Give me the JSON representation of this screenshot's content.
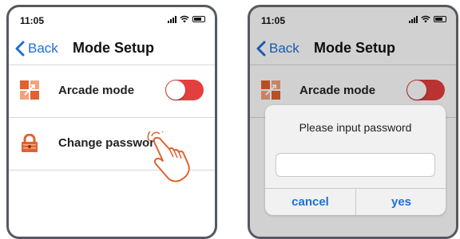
{
  "left_screen": {
    "status_time": "11:05",
    "back_label": "Back",
    "title": "Mode Setup",
    "rows": [
      {
        "label": "Arcade mode"
      },
      {
        "label": "Change password"
      }
    ]
  },
  "right_screen": {
    "status_time": "11:05",
    "back_label": "Back",
    "title": "Mode Setup",
    "rows": [
      {
        "label": "Arcade mode"
      }
    ],
    "dialog": {
      "title": "Please input password",
      "input_value": "",
      "cancel_label": "cancel",
      "yes_label": "yes"
    }
  },
  "colors": {
    "accent": "#1d6fd6",
    "toggle_on": "#e53e3e",
    "icon_orange": "#e0622e"
  },
  "icons": [
    "signal-icon",
    "wifi-icon",
    "battery-icon",
    "chevron-left-icon",
    "arcade-icon",
    "lock-icon",
    "hand-pointer-icon"
  ]
}
